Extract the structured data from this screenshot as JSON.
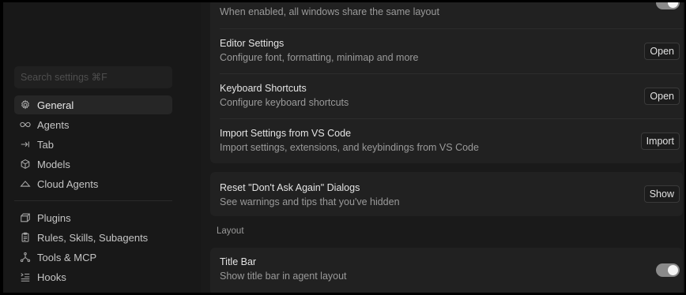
{
  "sidebar": {
    "search_placeholder": "Search settings ⌘F",
    "items": [
      {
        "label": "General",
        "icon": "gear-icon",
        "active": true
      },
      {
        "label": "Agents",
        "icon": "infinity-icon"
      },
      {
        "label": "Tab",
        "icon": "tab-arrow-icon"
      },
      {
        "label": "Models",
        "icon": "cube-icon"
      },
      {
        "label": "Cloud Agents",
        "icon": "cloud-icon"
      },
      {
        "label": "Plugins",
        "icon": "package-icon"
      },
      {
        "label": "Rules, Skills, Subagents",
        "icon": "clipboard-icon"
      },
      {
        "label": "Tools & MCP",
        "icon": "tools-network-icon"
      },
      {
        "label": "Hooks",
        "icon": "hooks-list-icon"
      }
    ]
  },
  "main": {
    "top_row": {
      "desc": "When enabled, all windows share the same layout",
      "toggle_on": true
    },
    "rows": [
      {
        "title": "Editor Settings",
        "desc": "Configure font, formatting, minimap and more",
        "button": "Open"
      },
      {
        "title": "Keyboard Shortcuts",
        "desc": "Configure keyboard shortcuts",
        "button": "Open"
      },
      {
        "title": "Import Settings from VS Code",
        "desc": "Import settings, extensions, and keybindings from VS Code",
        "button": "Import"
      }
    ],
    "reset": {
      "title": "Reset \"Don't Ask Again\" Dialogs",
      "desc": "See warnings and tips that you've hidden",
      "button": "Show"
    },
    "layout_section": {
      "label": "Layout",
      "title_bar": {
        "title": "Title Bar",
        "desc": "Show title bar in agent layout",
        "toggle_on": true
      }
    }
  },
  "colors": {
    "background": "#1a1a1a",
    "card": "#212121",
    "toggle_on": "#8a8a8a"
  }
}
